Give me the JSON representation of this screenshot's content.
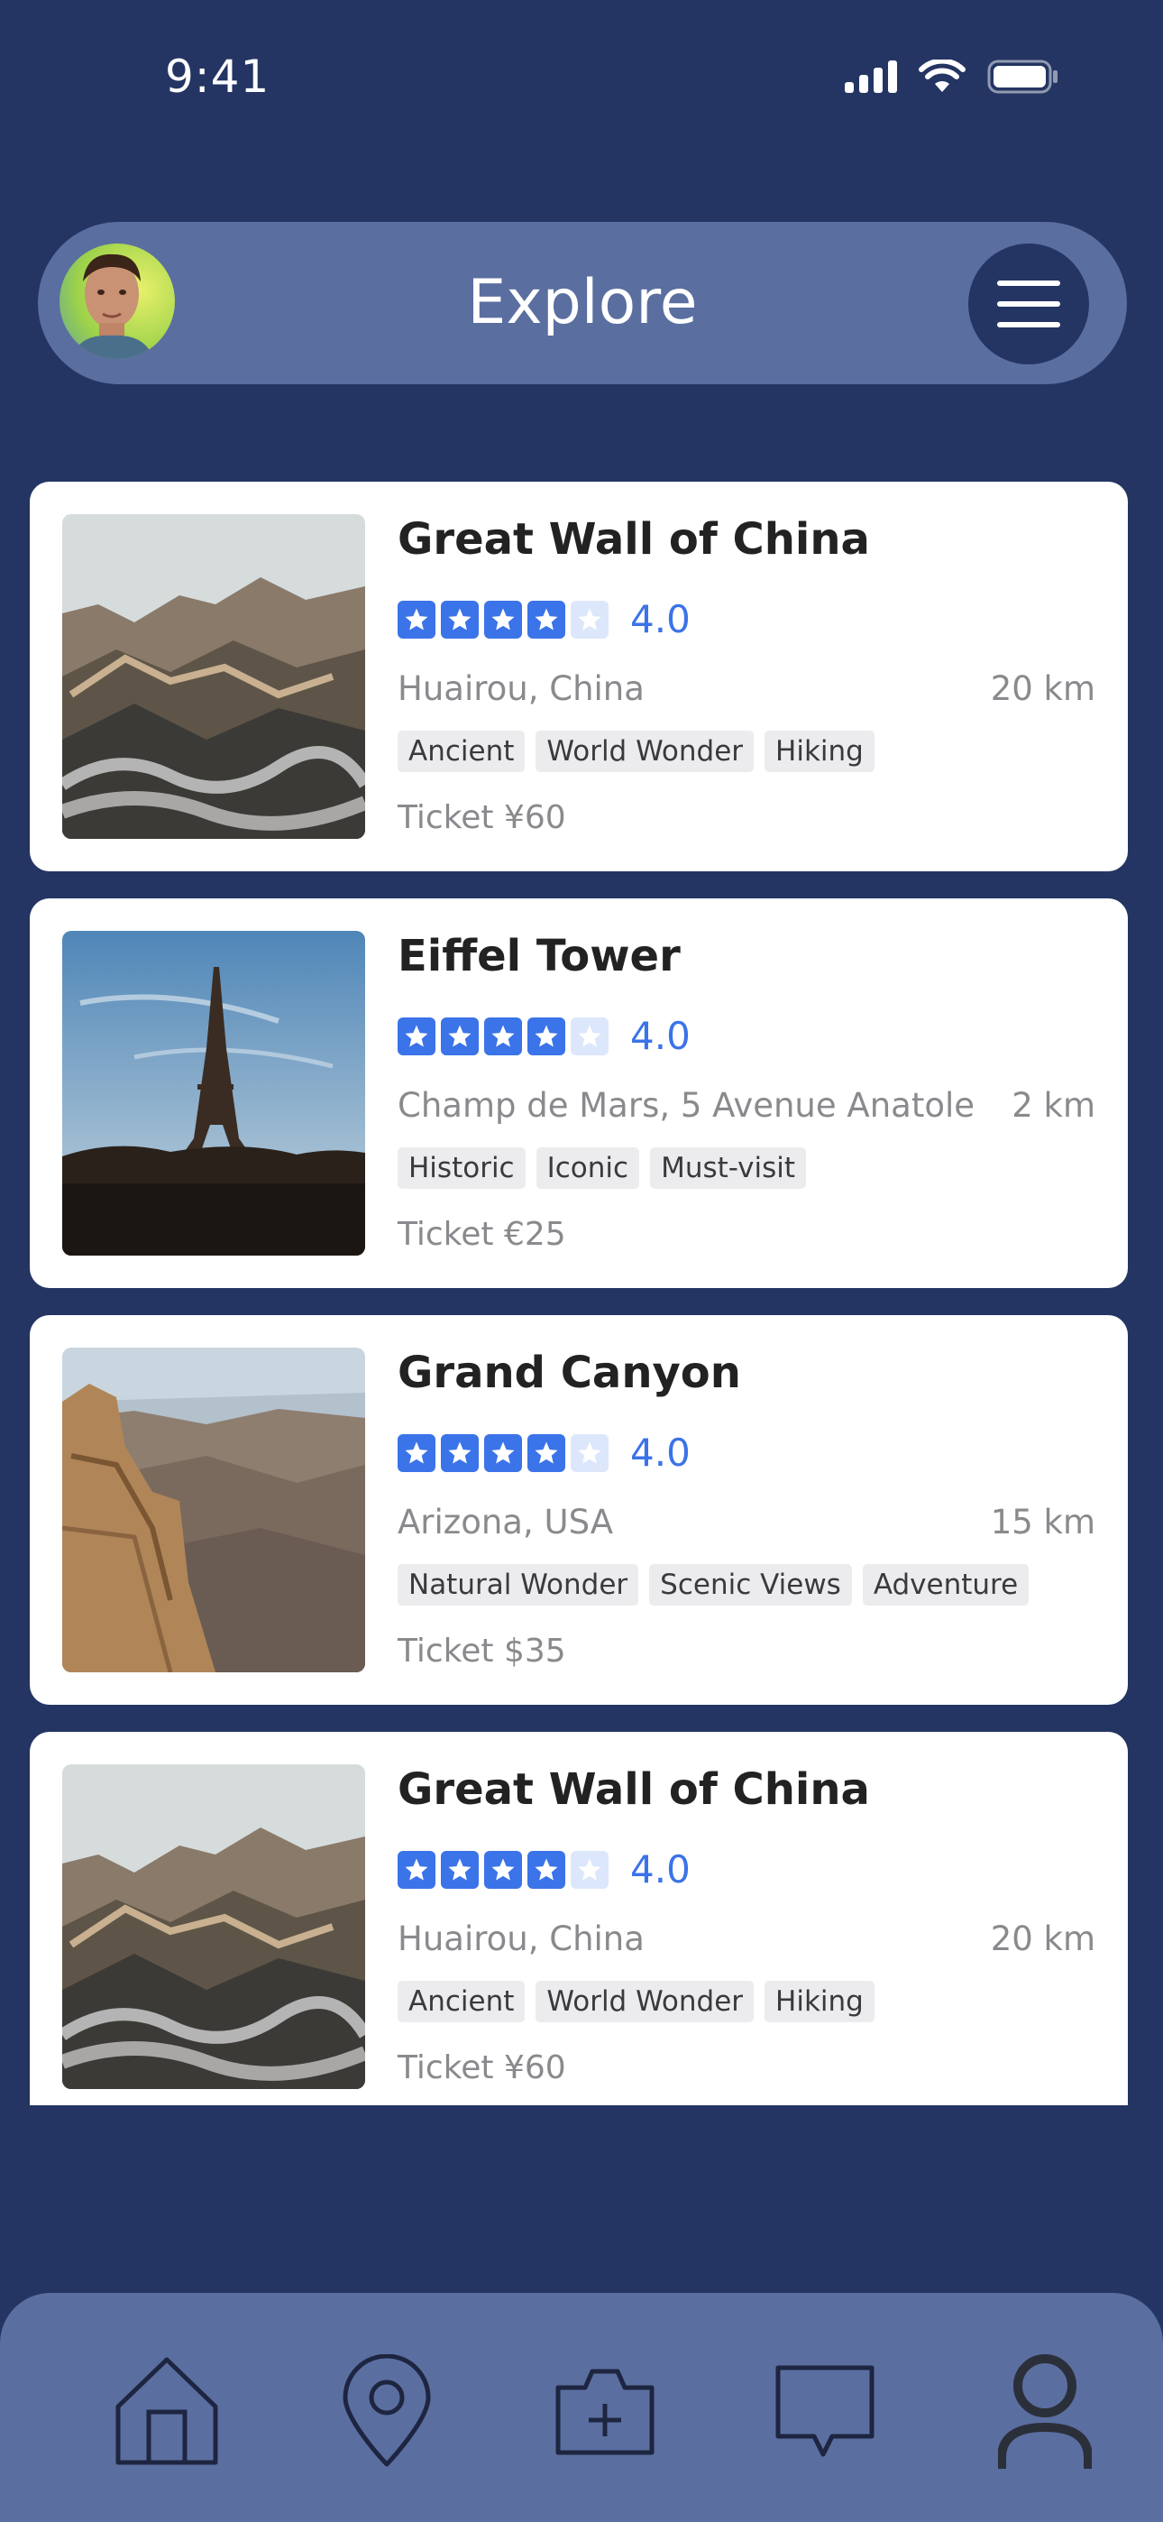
{
  "status": {
    "time": "9:41"
  },
  "header": {
    "title": "Explore"
  },
  "places": [
    {
      "name": "Great Wall of China",
      "rating": "4.0",
      "location": "Huairou, China",
      "distance": "20 km",
      "tags": [
        "Ancient",
        "World Wonder",
        "Hiking"
      ],
      "ticket": "Ticket ¥60"
    },
    {
      "name": "Eiffel Tower",
      "rating": "4.0",
      "location": "Champ de Mars, 5 Avenue Anatole ...",
      "distance": "2 km",
      "tags": [
        "Historic",
        "Iconic",
        "Must-visit"
      ],
      "ticket": "Ticket €25"
    },
    {
      "name": "Grand Canyon",
      "rating": "4.0",
      "location": "Arizona, USA",
      "distance": "15 km",
      "tags": [
        "Natural Wonder",
        "Scenic Views",
        "Adventure"
      ],
      "ticket": "Ticket $35"
    },
    {
      "name": "Great Wall of China",
      "rating": "4.0",
      "location": "Huairou, China",
      "distance": "20 km",
      "tags": [
        "Ancient",
        "World Wonder",
        "Hiking"
      ],
      "ticket": "Ticket ¥60"
    }
  ],
  "tabs": [
    {
      "icon": "home-icon"
    },
    {
      "icon": "location-pin-icon"
    },
    {
      "icon": "camera-add-icon"
    },
    {
      "icon": "chat-icon"
    },
    {
      "icon": "profile-icon"
    }
  ],
  "colors": {
    "background": "#243563",
    "header": "#5a6ea0",
    "accent": "#3b73e8"
  }
}
